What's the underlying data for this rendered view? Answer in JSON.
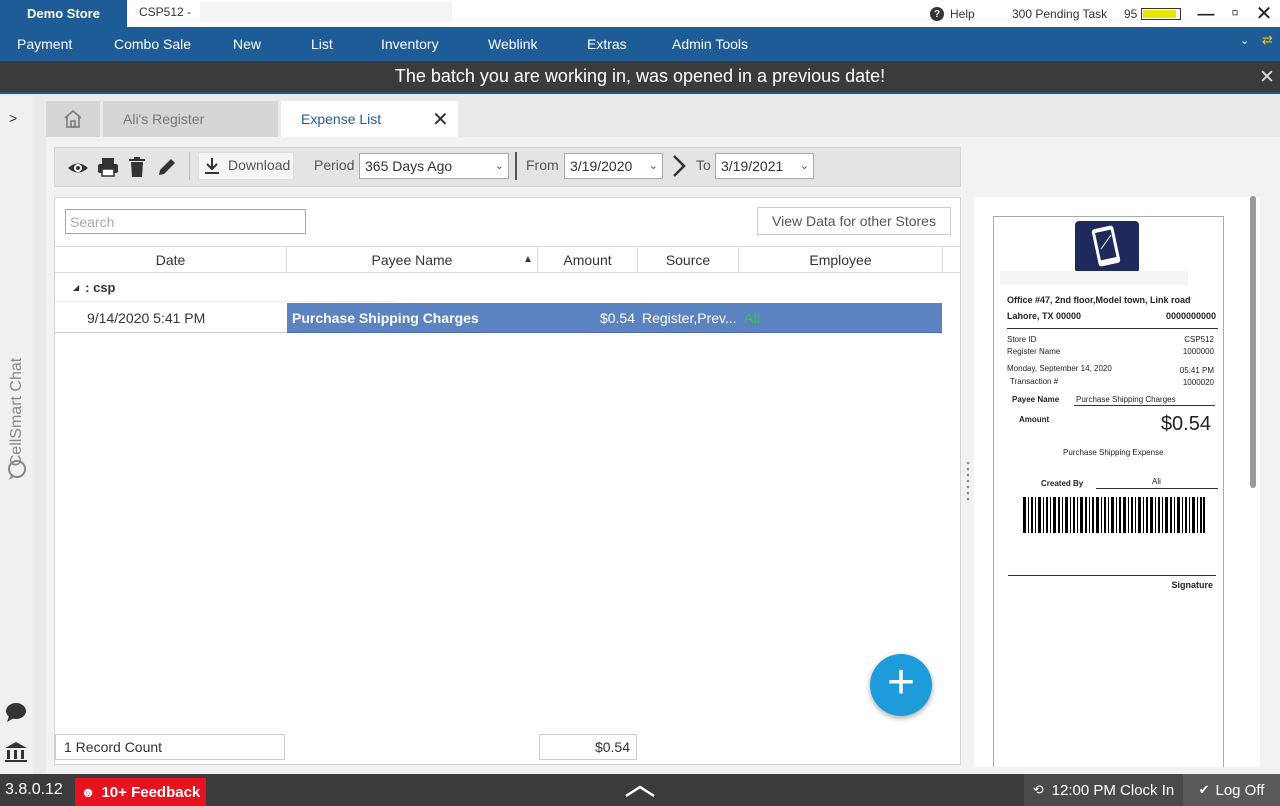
{
  "titlebar": {
    "store": "Demo Store",
    "store_code": "CSP512  -",
    "help": "Help",
    "pending": "300 Pending Task",
    "battery": "95",
    "battery_level": 0.92,
    "minimize": "—",
    "restore": "▫",
    "close": "✕"
  },
  "menu": [
    "Payment",
    "Combo Sale",
    "New",
    "List",
    "Inventory",
    "Weblink",
    "Extras",
    "Admin Tools"
  ],
  "banner": "The batch you are working in, was opened in a previous date!",
  "left_rail": {
    "chat": "CellSmart Chat",
    "expand": ">"
  },
  "tabs": {
    "register": "Ali's Register",
    "expense": "Expense List"
  },
  "toolbar": {
    "download": "Download",
    "period_label": "Period",
    "period_value": "365 Days Ago",
    "from_label": "From",
    "from_value": "3/19/2020",
    "to_label": "To",
    "to_value": "3/19/2021"
  },
  "grid": {
    "search_placeholder": "Search",
    "other_stores": "View Data for other Stores",
    "columns": [
      "Date",
      "Payee Name",
      "Amount",
      "Source",
      "Employee"
    ],
    "group": ": csp",
    "rows": [
      {
        "date": "9/14/2020 5:41 PM",
        "payee": "Purchase Shipping Charges",
        "amount": "$0.54",
        "source": "Register,Prev...",
        "employee": "Ali"
      }
    ],
    "record_count": "1 Record Count",
    "total": "$0.54"
  },
  "receipt": {
    "address1": "Office #47, 2nd floor,Model town, Link road",
    "city": "Lahore, TX 00000",
    "phone": "0000000000",
    "store_id_label": "Store ID",
    "store_id": "CSP512",
    "register_label": "Register Name",
    "register": "1000000",
    "date": "Monday, September 14, 2020",
    "time": "05:41 PM",
    "txn_label": "Transaction #",
    "txn": "1000020",
    "payee_label": "Payee Name",
    "payee": "Purchase Shipping Charges",
    "amount_label": "Amount",
    "amount": "$0.54",
    "expense": "Purchase Shipping Expense",
    "created_label": "Created By",
    "created_by": "Ali",
    "signature": "Signature"
  },
  "status": {
    "version": "3.8.0.12",
    "feedback": "10+ Feedback",
    "clock_in": "12:00 PM Clock In",
    "log_off": "Log Off"
  },
  "colors": {
    "primary": "#1d5c96",
    "selected_row": "#5b82c1",
    "fab": "#1e9bdb",
    "feedback": "#e8121e",
    "employee_text": "#2ecc40"
  }
}
